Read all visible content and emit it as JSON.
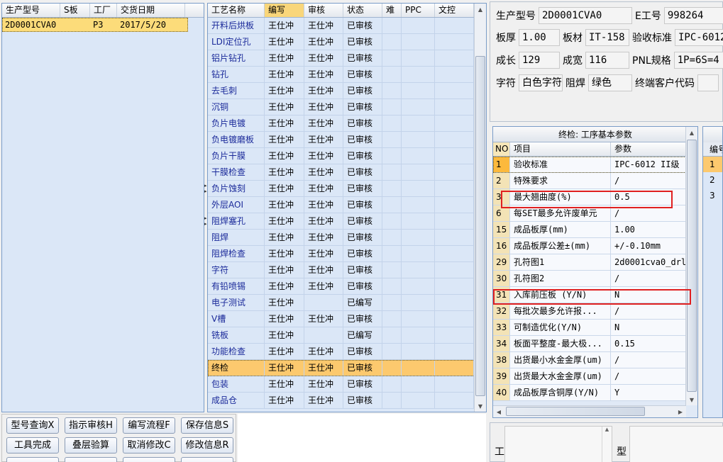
{
  "left_list": {
    "headers": [
      "生产型号",
      "S板",
      "工厂",
      "交货日期"
    ],
    "rows": [
      {
        "model": "2D0001CVA0",
        "s_board": "",
        "factory": "P3",
        "date": "2017/5/20"
      }
    ]
  },
  "process_grid": {
    "headers": [
      "工艺名称",
      "编写",
      "审核",
      "状态",
      "难",
      "PPC",
      "文控"
    ],
    "rows": [
      {
        "name": "开料后烘板",
        "author": "王仕冲",
        "reviewer": "王仕冲",
        "status": "已审核"
      },
      {
        "name": "LDI定位孔",
        "author": "王仕冲",
        "reviewer": "王仕冲",
        "status": "已审核"
      },
      {
        "name": "铝片钻孔",
        "author": "王仕冲",
        "reviewer": "王仕冲",
        "status": "已审核"
      },
      {
        "name": "钻孔",
        "author": "王仕冲",
        "reviewer": "王仕冲",
        "status": "已审核"
      },
      {
        "name": "去毛刺",
        "author": "王仕冲",
        "reviewer": "王仕冲",
        "status": "已审核"
      },
      {
        "name": "沉铜",
        "author": "王仕冲",
        "reviewer": "王仕冲",
        "status": "已审核"
      },
      {
        "name": "负片电镀",
        "author": "王仕冲",
        "reviewer": "王仕冲",
        "status": "已审核"
      },
      {
        "name": "负电镀磨板",
        "author": "王仕冲",
        "reviewer": "王仕冲",
        "status": "已审核"
      },
      {
        "name": "负片干膜",
        "author": "王仕冲",
        "reviewer": "王仕冲",
        "status": "已审核"
      },
      {
        "name": "干膜检查",
        "author": "王仕冲",
        "reviewer": "王仕冲",
        "status": "已审核"
      },
      {
        "name": "负片蚀刻",
        "author": "王仕冲",
        "reviewer": "王仕冲",
        "status": "已审核"
      },
      {
        "name": "外层AOI",
        "author": "王仕冲",
        "reviewer": "王仕冲",
        "status": "已审核"
      },
      {
        "name": "阻焊塞孔",
        "author": "王仕冲",
        "reviewer": "王仕冲",
        "status": "已审核"
      },
      {
        "name": "阻焊",
        "author": "王仕冲",
        "reviewer": "王仕冲",
        "status": "已审核"
      },
      {
        "name": "阻焊检查",
        "author": "王仕冲",
        "reviewer": "王仕冲",
        "status": "已审核"
      },
      {
        "name": "字符",
        "author": "王仕冲",
        "reviewer": "王仕冲",
        "status": "已审核"
      },
      {
        "name": "有铅喷锡",
        "author": "王仕冲",
        "reviewer": "王仕冲",
        "status": "已审核"
      },
      {
        "name": "电子测试",
        "author": "王仕冲",
        "reviewer": "",
        "status": "已编写"
      },
      {
        "name": "V槽",
        "author": "王仕冲",
        "reviewer": "王仕冲",
        "status": "已审核"
      },
      {
        "name": "铣板",
        "author": "王仕冲",
        "reviewer": "",
        "status": "已编写"
      },
      {
        "name": "功能检查",
        "author": "王仕冲",
        "reviewer": "王仕冲",
        "status": "已审核"
      },
      {
        "name": "终检",
        "author": "王仕冲",
        "reviewer": "王仕冲",
        "status": "已审核",
        "selected": true
      },
      {
        "name": "包装",
        "author": "王仕冲",
        "reviewer": "王仕冲",
        "status": "已审核"
      },
      {
        "name": "成品仓",
        "author": "王仕冲",
        "reviewer": "王仕冲",
        "status": "已审核"
      }
    ]
  },
  "info": {
    "model_label": "生产型号",
    "model_value": "2D0001CVA0",
    "eid_label": "E工号",
    "eid_value": "998264",
    "thickness_label": "板厚",
    "thickness_value": "1.00",
    "material_label": "板材",
    "material_value": "IT-158",
    "standard_label": "验收标准",
    "standard_value": "IPC-6012",
    "length_label": "成长",
    "length_value": "129",
    "width_label": "成宽",
    "width_value": "116",
    "pnl_label": "PNL规格",
    "pnl_value": "1P=6S=4",
    "silk_label": "字符",
    "silk_value": "白色字符",
    "mask_label": "阻焊",
    "mask_value": "绿色",
    "customer_label": "终端客户代码",
    "customer_value": ""
  },
  "param_grid": {
    "title": "终检: 工序基本参数",
    "headers": [
      "NO",
      "项目",
      "参数"
    ],
    "rows": [
      {
        "no": "1",
        "item": "验收标准",
        "value": "IPC-6012 II级",
        "selected": true
      },
      {
        "no": "2",
        "item": "特殊要求",
        "value": "/"
      },
      {
        "no": "3",
        "item": "最大翘曲度(%)",
        "value": "0.5"
      },
      {
        "no": "6",
        "item": "每SET最多允许废单元",
        "value": "/"
      },
      {
        "no": "15",
        "item": "成品板厚(mm)",
        "value": "1.00"
      },
      {
        "no": "16",
        "item": "成品板厚公差±(mm)",
        "value": "+/-0.10mm"
      },
      {
        "no": "29",
        "item": "孔符图1",
        "value": "2d0001cva0_drl_"
      },
      {
        "no": "30",
        "item": "孔符图2",
        "value": "/"
      },
      {
        "no": "31",
        "item": "入库前压板 (Y/N)",
        "value": "N"
      },
      {
        "no": "32",
        "item": "每批次最多允许报...",
        "value": "/"
      },
      {
        "no": "33",
        "item": "可制造优化(Y/N)",
        "value": "N"
      },
      {
        "no": "34",
        "item": "板面平整度-最大极...",
        "value": "0.15"
      },
      {
        "no": "38",
        "item": "出货最小水金金厚(um)",
        "value": "/"
      },
      {
        "no": "39",
        "item": "出货最大水金金厚(um)",
        "value": "/"
      },
      {
        "no": "40",
        "item": "成品板厚含铜厚(Y/N)",
        "value": "Y"
      }
    ]
  },
  "side_grid": {
    "header": "编号",
    "rows": [
      "1",
      "2",
      "3"
    ]
  },
  "buttons": {
    "model_query": "型号查询X",
    "instruction_review": "指示审核H",
    "write_flow": "编写流程F",
    "save_info": "保存信息S",
    "tool_complete": "工具完成",
    "stack_check": "叠层验算",
    "cancel_modify": "取消修改C",
    "modify_info": "修改信息R"
  },
  "bottom": {
    "label_a": "工",
    "label_b": "型"
  },
  "colors": {
    "selected_row": "#fcc96e",
    "highlight_box": "#e02020",
    "grid_background": "#dbe7f7"
  }
}
